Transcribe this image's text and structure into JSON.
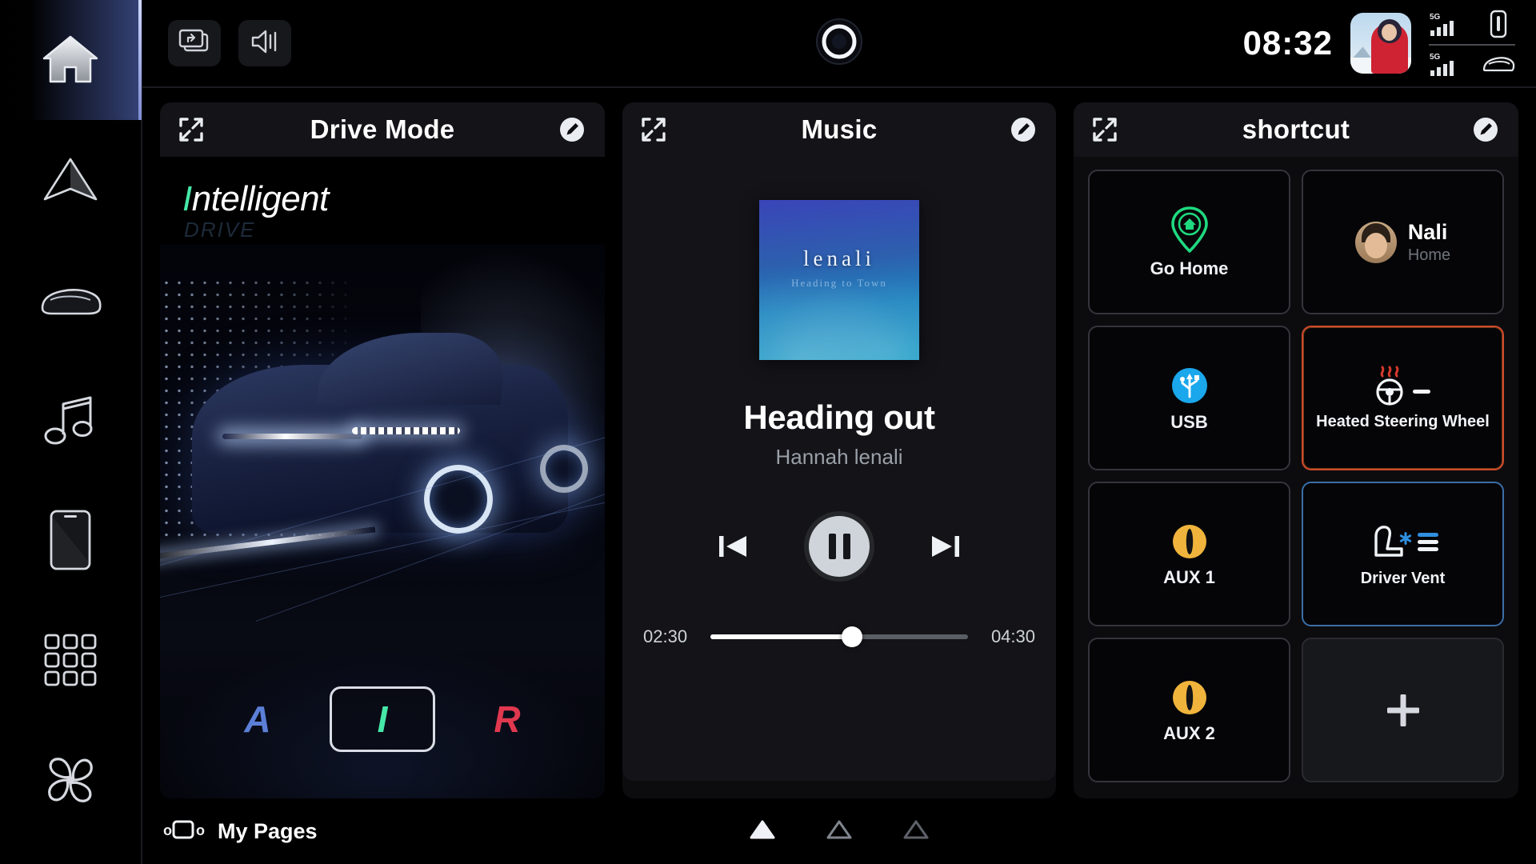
{
  "sidebar": {
    "items": [
      {
        "name": "home",
        "icon": "home-icon",
        "active": true
      },
      {
        "name": "navigation",
        "icon": "navigation-arrow-icon",
        "active": false
      },
      {
        "name": "vehicle",
        "icon": "car-icon",
        "active": false
      },
      {
        "name": "media",
        "icon": "music-note-icon",
        "active": false
      },
      {
        "name": "phone",
        "icon": "phone-icon",
        "active": false
      },
      {
        "name": "apps",
        "icon": "app-grid-icon",
        "active": false
      },
      {
        "name": "climate",
        "icon": "fan-icon",
        "active": false
      }
    ]
  },
  "statusbar": {
    "screen_share_icon": "screen-share-icon",
    "volume_icon": "volume-speaker-icon",
    "assistant_icon": "voice-assistant-icon",
    "clock": "08:32",
    "profile_icon": "profile-avatar",
    "connectivity": {
      "phone_network_label": "5G",
      "phone_device_icon": "phone-device-icon",
      "car_network_label": "5G",
      "car_device_icon": "car-device-icon"
    }
  },
  "drive_mode": {
    "title": "Drive Mode",
    "expand_icon": "expand-icon",
    "edit_icon": "edit-pencil-icon",
    "mode_name_highlight": "I",
    "mode_name_rest": "ntelligent",
    "mode_sub": "DRIVE",
    "modes": [
      {
        "key": "A",
        "label": "A",
        "color": "#5b7fd6",
        "selected": false
      },
      {
        "key": "I",
        "label": "I",
        "color": "#46e8a8",
        "selected": true
      },
      {
        "key": "R",
        "label": "R",
        "color": "#e0384f",
        "selected": false
      }
    ]
  },
  "music": {
    "title": "Music",
    "expand_icon": "expand-icon",
    "edit_icon": "edit-pencil-icon",
    "album_art_title": "lenali",
    "album_art_subtitle": "Heading to Town",
    "track_title": "Heading out",
    "track_artist": "Hannah lenali",
    "prev_icon": "skip-previous-icon",
    "play_pause_icon": "pause-icon",
    "next_icon": "skip-next-icon",
    "elapsed": "02:30",
    "duration": "04:30",
    "progress_percent": 55
  },
  "shortcut": {
    "title": "shortcut",
    "expand_icon": "expand-icon",
    "edit_icon": "edit-pencil-icon",
    "tiles": [
      {
        "label": "Go Home",
        "icon": "map-pin-home-icon",
        "type": "standard",
        "highlight": "none"
      },
      {
        "label": "Nali",
        "sub": "Home",
        "icon": "contact-avatar",
        "type": "contact",
        "highlight": "none"
      },
      {
        "label": "USB",
        "icon": "usb-icon",
        "type": "standard",
        "highlight": "none"
      },
      {
        "label": "Heated Steering Wheel",
        "icon": "heated-steering-wheel-icon",
        "type": "standard",
        "highlight": "red"
      },
      {
        "label": "AUX 1",
        "icon": "aux-icon",
        "type": "standard",
        "highlight": "none"
      },
      {
        "label": "Driver Vent",
        "icon": "driver-vent-icon",
        "type": "standard",
        "highlight": "blue"
      },
      {
        "label": "AUX 2",
        "icon": "aux-icon",
        "type": "standard",
        "highlight": "none"
      },
      {
        "label": "+",
        "icon": "plus-icon",
        "type": "add",
        "highlight": "none"
      }
    ]
  },
  "bottombar": {
    "my_pages_label": "My Pages",
    "my_pages_icon": "pages-carousel-icon",
    "page_indicators": [
      {
        "active": true
      },
      {
        "active": false
      },
      {
        "active": false
      }
    ]
  },
  "colors": {
    "accent_green": "#46e8a8",
    "mode_a_blue": "#5b7fd6",
    "mode_r_red": "#e0384f",
    "usb_blue": "#1aa7ec",
    "aux_amber": "#f0b43c",
    "home_pin_green": "#1fd97f",
    "highlight_red": "#cf4a2c",
    "highlight_blue": "#3a6ea8",
    "background": "#000000",
    "card_background": "#0c0c0f"
  }
}
